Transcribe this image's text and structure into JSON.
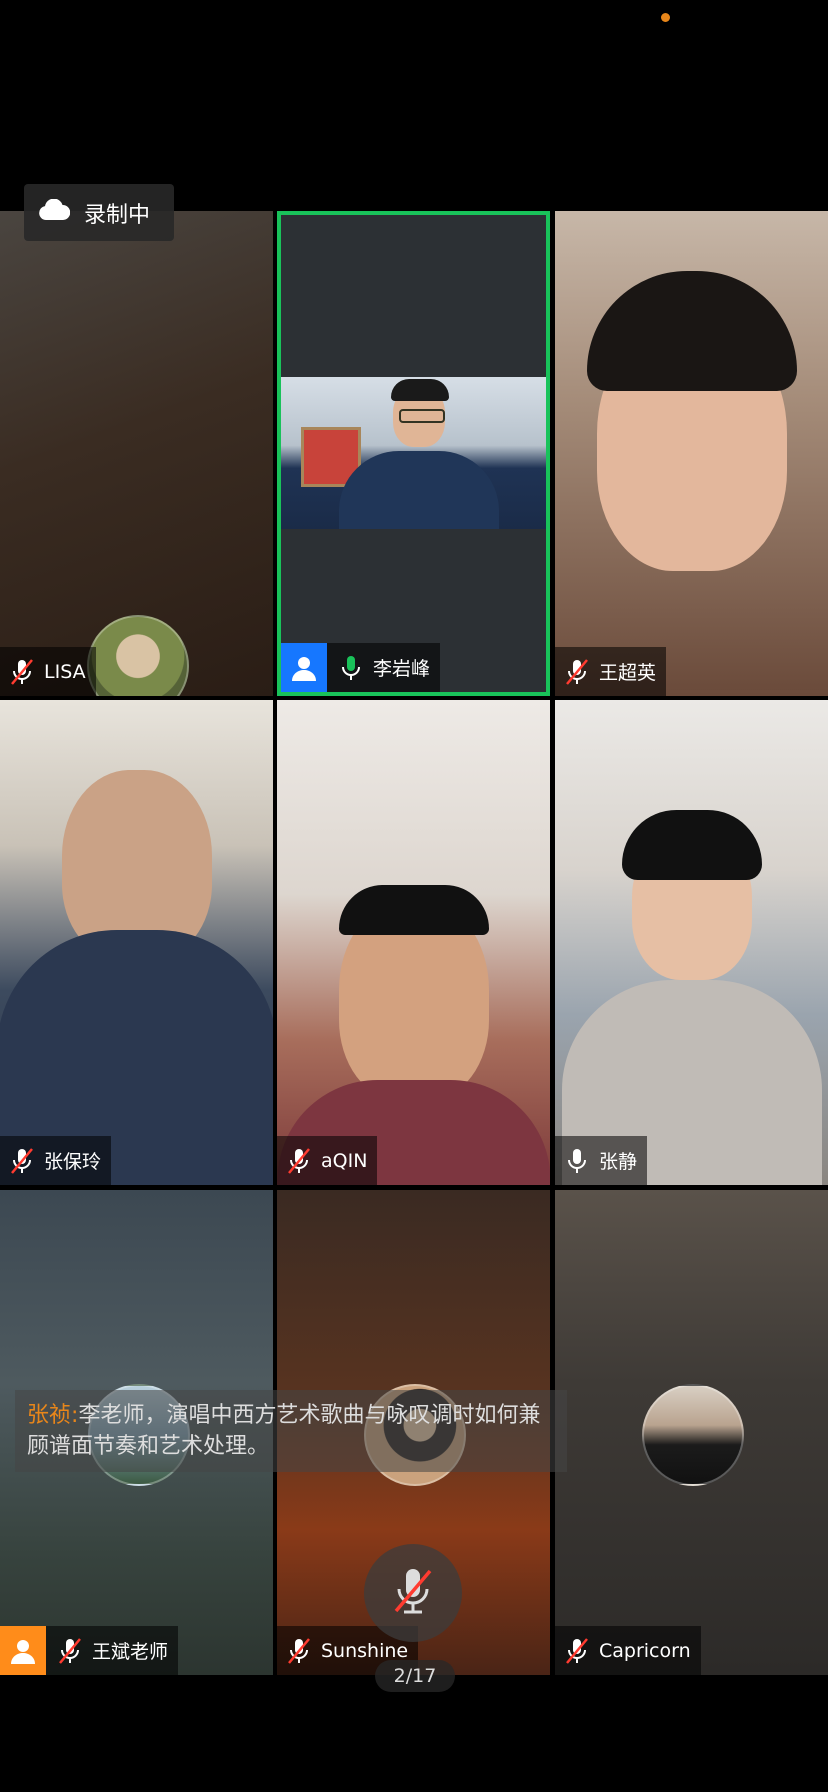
{
  "status": {
    "recording_label": "录制中"
  },
  "participants": [
    {
      "name": "LISA",
      "mic": "muted"
    },
    {
      "name": "李岩峰",
      "mic": "active",
      "speaking": true,
      "host_badge": "blue"
    },
    {
      "name": "王超英",
      "mic": "muted"
    },
    {
      "name": "张保玲",
      "mic": "muted"
    },
    {
      "name": "aQIN",
      "mic": "muted"
    },
    {
      "name": "张静",
      "mic": "on"
    },
    {
      "name": "王斌老师",
      "mic": "muted",
      "host_badge": "orange"
    },
    {
      "name": "Sunshine",
      "mic": "muted"
    },
    {
      "name": "Capricorn",
      "mic": "muted"
    }
  ],
  "chat_bubble": {
    "sender": "张祯",
    "separator": ":",
    "message": "李老师，演唱中西方艺术歌曲与咏叹调时如何兼顾谱面节奏和艺术处理。"
  },
  "controls": {
    "mic_toggle": "mic-muted-icon"
  },
  "pager": {
    "label": "2/17"
  },
  "colors": {
    "speaking_border": "#19c25a",
    "muted_red": "#ff3b30",
    "accent_orange": "#e8861a",
    "badge_blue": "#1677ff"
  }
}
